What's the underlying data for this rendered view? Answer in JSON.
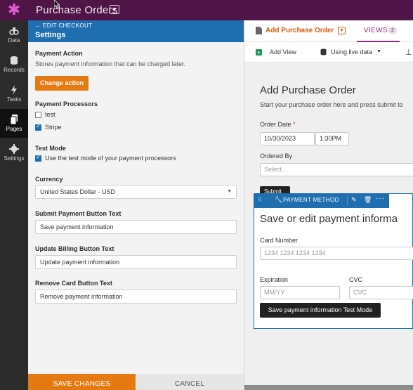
{
  "app": {
    "title": "Purchase Orders",
    "dropdown_icon": "chevron-down-icon",
    "logo_icon": "asterisk-logo",
    "brand_color": "#4f1546"
  },
  "nav": {
    "items": [
      {
        "label": "Data",
        "icon": "data-icon"
      },
      {
        "label": "Records",
        "icon": "database-icon"
      },
      {
        "label": "Tasks",
        "icon": "bolt-icon"
      },
      {
        "label": "Pages",
        "icon": "pages-icon",
        "active": true
      },
      {
        "label": "Settings",
        "icon": "gear-icon"
      }
    ]
  },
  "panel": {
    "back_label": "EDIT CHECKOUT",
    "title": "Settings",
    "payment_action": {
      "title": "Payment Action",
      "description": "Stores payment information that can be charged later.",
      "button": "Change action"
    },
    "processors": {
      "title": "Payment Processors",
      "items": [
        {
          "label": "test",
          "checked": false
        },
        {
          "label": "Stripe",
          "checked": true
        }
      ]
    },
    "test_mode": {
      "title": "Test Mode",
      "label": "Use the test mode of your payment processors",
      "checked": true
    },
    "currency": {
      "title": "Currency",
      "value": "United States Dollar - USD"
    },
    "submit_text": {
      "title": "Submit Payment Button Text",
      "value": "Save payment information"
    },
    "update_text": {
      "title": "Update Billing Button Text",
      "value": "Update payment information"
    },
    "remove_text": {
      "title": "Remove Card Button Text",
      "value": "Remove payment information"
    },
    "save_button": "SAVE CHANGES",
    "cancel_button": "CANCEL",
    "accent_color": "#e57a12",
    "header_color": "#1f6fb0"
  },
  "page": {
    "title": "Add Purchase Order",
    "views_label": "VIEWS",
    "views_count": "2",
    "add_view": "Add View",
    "data_source": "Using live data"
  },
  "form": {
    "title": "Add Purchase Order",
    "subtitle": "Start your purchase order here and press submit to",
    "order_date_label": "Order Date",
    "required_mark": "*",
    "date_value": "10/30/2023",
    "time_value": "1:30PM",
    "ordered_by_label": "Ordered By",
    "ordered_by_placeholder": "Select...",
    "submit_label": "Submit"
  },
  "payment_block": {
    "bar_label": "PAYMENT METHOD",
    "title": "Save or edit payment informa",
    "card_label": "Card Number",
    "card_placeholder": "1234 1234 1234 1234",
    "expiration_label": "Expiration",
    "expiration_placeholder": "MM/YY",
    "cvc_label": "CVC",
    "cvc_placeholder": "CVC",
    "button": "Save payment information Test Mode"
  }
}
